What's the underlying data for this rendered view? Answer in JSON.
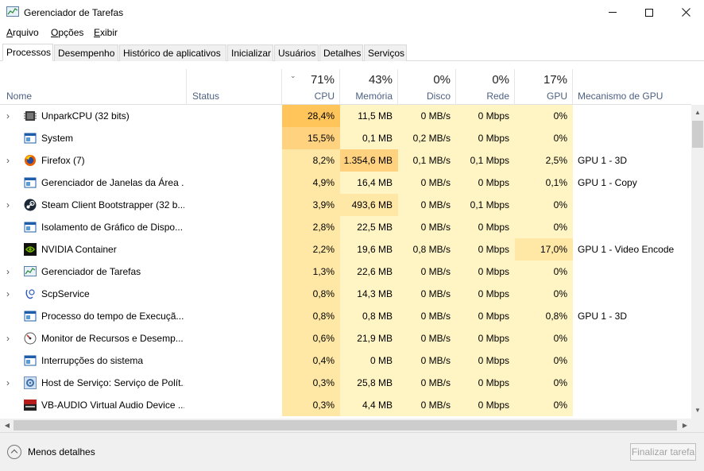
{
  "window": {
    "title": "Gerenciador de Tarefas"
  },
  "menu": [
    {
      "label": "Arquivo",
      "accel_index": 0
    },
    {
      "label": "Opções",
      "accel_index": 0
    },
    {
      "label": "Exibir",
      "accel_index": 0
    }
  ],
  "tabs": [
    "Processos",
    "Desempenho",
    "Histórico de aplicativos",
    "Inicializar",
    "Usuários",
    "Detalhes",
    "Serviços"
  ],
  "active_tab": "Processos",
  "columns": {
    "name": "Nome",
    "status": "Status",
    "cpu": {
      "pct": "71%",
      "label": "CPU"
    },
    "memory": {
      "pct": "43%",
      "label": "Memória"
    },
    "disk": {
      "pct": "0%",
      "label": "Disco"
    },
    "network": {
      "pct": "0%",
      "label": "Rede"
    },
    "gpu": {
      "pct": "17%",
      "label": "GPU"
    },
    "gpu_engine": "Mecanismo de GPU"
  },
  "processes": [
    {
      "name": "UnparkCPU (32 bits)",
      "icon": "cpu-chip-icon",
      "expandable": true,
      "cpu": "28,4%",
      "memory": "11,5 MB",
      "disk": "0 MB/s",
      "network": "0 Mbps",
      "gpu": "0%",
      "gpu_engine": ""
    },
    {
      "name": "System",
      "icon": "system-window-icon",
      "expandable": false,
      "cpu": "15,5%",
      "memory": "0,1 MB",
      "disk": "0,2 MB/s",
      "network": "0 Mbps",
      "gpu": "0%",
      "gpu_engine": ""
    },
    {
      "name": "Firefox (7)",
      "icon": "firefox-icon",
      "expandable": true,
      "cpu": "8,2%",
      "memory": "1.354,6 MB",
      "disk": "0,1 MB/s",
      "network": "0,1 Mbps",
      "gpu": "2,5%",
      "gpu_engine": "GPU 1 - 3D"
    },
    {
      "name": "Gerenciador de Janelas da Área ...",
      "icon": "system-window-icon",
      "expandable": false,
      "cpu": "4,9%",
      "memory": "16,4 MB",
      "disk": "0 MB/s",
      "network": "0 Mbps",
      "gpu": "0,1%",
      "gpu_engine": "GPU 1 - Copy"
    },
    {
      "name": "Steam Client Bootstrapper (32 b...",
      "icon": "steam-icon",
      "expandable": true,
      "cpu": "3,9%",
      "memory": "493,6 MB",
      "disk": "0 MB/s",
      "network": "0,1 Mbps",
      "gpu": "0%",
      "gpu_engine": ""
    },
    {
      "name": "Isolamento de Gráfico de Dispo...",
      "icon": "system-window-icon",
      "expandable": false,
      "cpu": "2,8%",
      "memory": "22,5 MB",
      "disk": "0 MB/s",
      "network": "0 Mbps",
      "gpu": "0%",
      "gpu_engine": ""
    },
    {
      "name": "NVIDIA Container",
      "icon": "nvidia-icon",
      "expandable": false,
      "cpu": "2,2%",
      "memory": "19,6 MB",
      "disk": "0,8 MB/s",
      "network": "0 Mbps",
      "gpu": "17,0%",
      "gpu_engine": "GPU 1 - Video Encode"
    },
    {
      "name": "Gerenciador de Tarefas",
      "icon": "task-manager-icon",
      "expandable": true,
      "cpu": "1,3%",
      "memory": "22,6 MB",
      "disk": "0 MB/s",
      "network": "0 Mbps",
      "gpu": "0%",
      "gpu_engine": ""
    },
    {
      "name": "ScpService",
      "icon": "scp-service-icon",
      "expandable": true,
      "cpu": "0,8%",
      "memory": "14,3 MB",
      "disk": "0 MB/s",
      "network": "0 Mbps",
      "gpu": "0%",
      "gpu_engine": ""
    },
    {
      "name": "Processo do tempo de Execuçã...",
      "icon": "system-window-icon",
      "expandable": false,
      "cpu": "0,8%",
      "memory": "0,8 MB",
      "disk": "0 MB/s",
      "network": "0 Mbps",
      "gpu": "0,8%",
      "gpu_engine": "GPU 1 - 3D"
    },
    {
      "name": "Monitor de Recursos e Desemp...",
      "icon": "resource-monitor-icon",
      "expandable": true,
      "cpu": "0,6%",
      "memory": "21,9 MB",
      "disk": "0 MB/s",
      "network": "0 Mbps",
      "gpu": "0%",
      "gpu_engine": ""
    },
    {
      "name": "Interrupções do sistema",
      "icon": "system-window-icon",
      "expandable": false,
      "cpu": "0,4%",
      "memory": "0 MB",
      "disk": "0 MB/s",
      "network": "0 Mbps",
      "gpu": "0%",
      "gpu_engine": ""
    },
    {
      "name": "Host de Serviço: Serviço de Polít...",
      "icon": "gear-icon",
      "expandable": true,
      "cpu": "0,3%",
      "memory": "25,8 MB",
      "disk": "0 MB/s",
      "network": "0 Mbps",
      "gpu": "0%",
      "gpu_engine": ""
    },
    {
      "name": "VB-AUDIO Virtual Audio Device ...",
      "icon": "vb-audio-icon",
      "expandable": false,
      "cpu": "0,3%",
      "memory": "4,4 MB",
      "disk": "0 MB/s",
      "network": "0 Mbps",
      "gpu": "0%",
      "gpu_engine": ""
    }
  ],
  "footer": {
    "less_details": "Menos detalhes",
    "end_task": "Finalizar tarefa"
  },
  "colors": {
    "heat_light": "#fff4c4",
    "heat_medium": "#ffe8a6",
    "heat_high": "#ffd280",
    "heat_max": "#ffc45a",
    "sort_column": "#fff9e4",
    "header_label": "#4d6082"
  }
}
